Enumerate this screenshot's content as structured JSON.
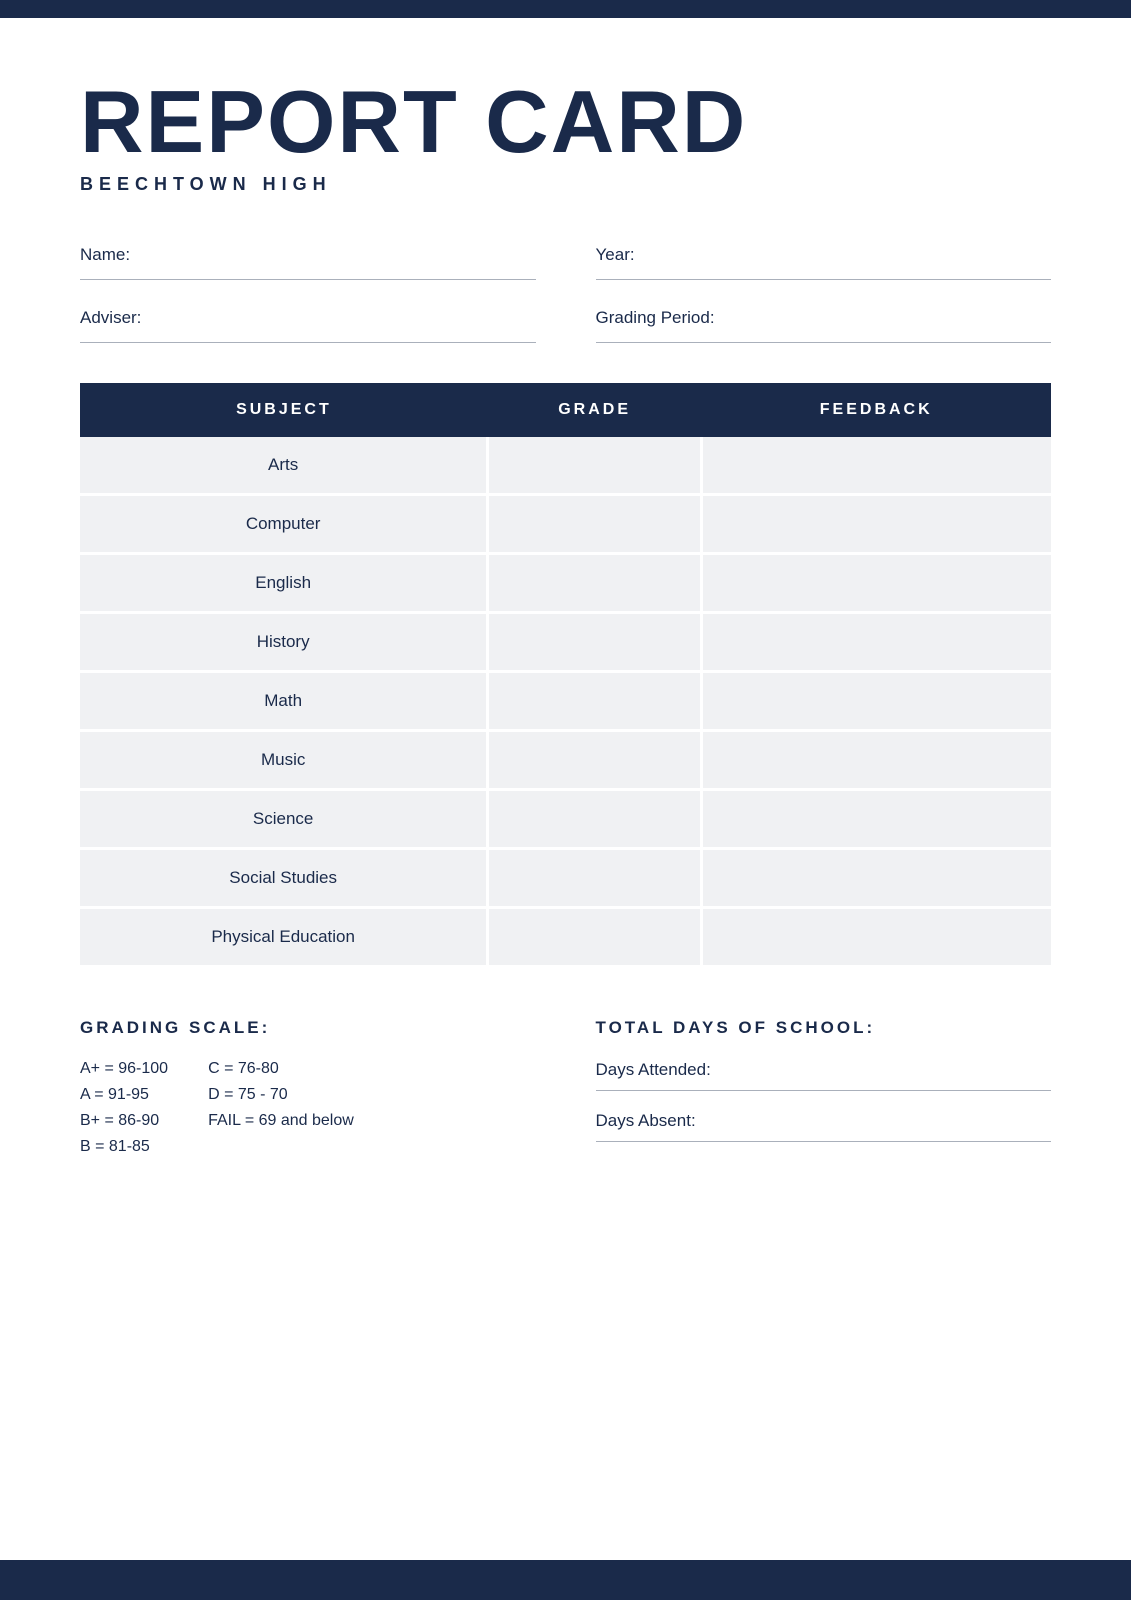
{
  "topBar": {},
  "header": {
    "title": "REPORT CARD",
    "schoolName": "BEECHTOWN HIGH"
  },
  "form": {
    "nameLabel": "Name:",
    "yearLabel": "Year:",
    "adviserLabel": "Adviser:",
    "gradingPeriodLabel": "Grading Period:"
  },
  "table": {
    "headers": {
      "subject": "SUBJECT",
      "grade": "GRADE",
      "feedback": "FEEDBACK"
    },
    "rows": [
      {
        "subject": "Arts",
        "grade": "",
        "feedback": ""
      },
      {
        "subject": "Computer",
        "grade": "",
        "feedback": ""
      },
      {
        "subject": "English",
        "grade": "",
        "feedback": ""
      },
      {
        "subject": "History",
        "grade": "",
        "feedback": ""
      },
      {
        "subject": "Math",
        "grade": "",
        "feedback": ""
      },
      {
        "subject": "Music",
        "grade": "",
        "feedback": ""
      },
      {
        "subject": "Science",
        "grade": "",
        "feedback": ""
      },
      {
        "subject": "Social Studies",
        "grade": "",
        "feedback": ""
      },
      {
        "subject": "Physical Education",
        "grade": "",
        "feedback": ""
      }
    ]
  },
  "gradingScale": {
    "title": "GRADING SCALE:",
    "col1": [
      "A+ = 96-100",
      "A = 91-95",
      "B+ = 86-90",
      "B = 81-85"
    ],
    "col2": [
      "C = 76-80",
      "D = 75 - 70",
      "FAIL = 69 and below"
    ]
  },
  "totalDays": {
    "title": "TOTAL DAYS OF SCHOOL:",
    "daysAttendedLabel": "Days Attended:",
    "daysAbsentLabel": "Days Absent:"
  }
}
